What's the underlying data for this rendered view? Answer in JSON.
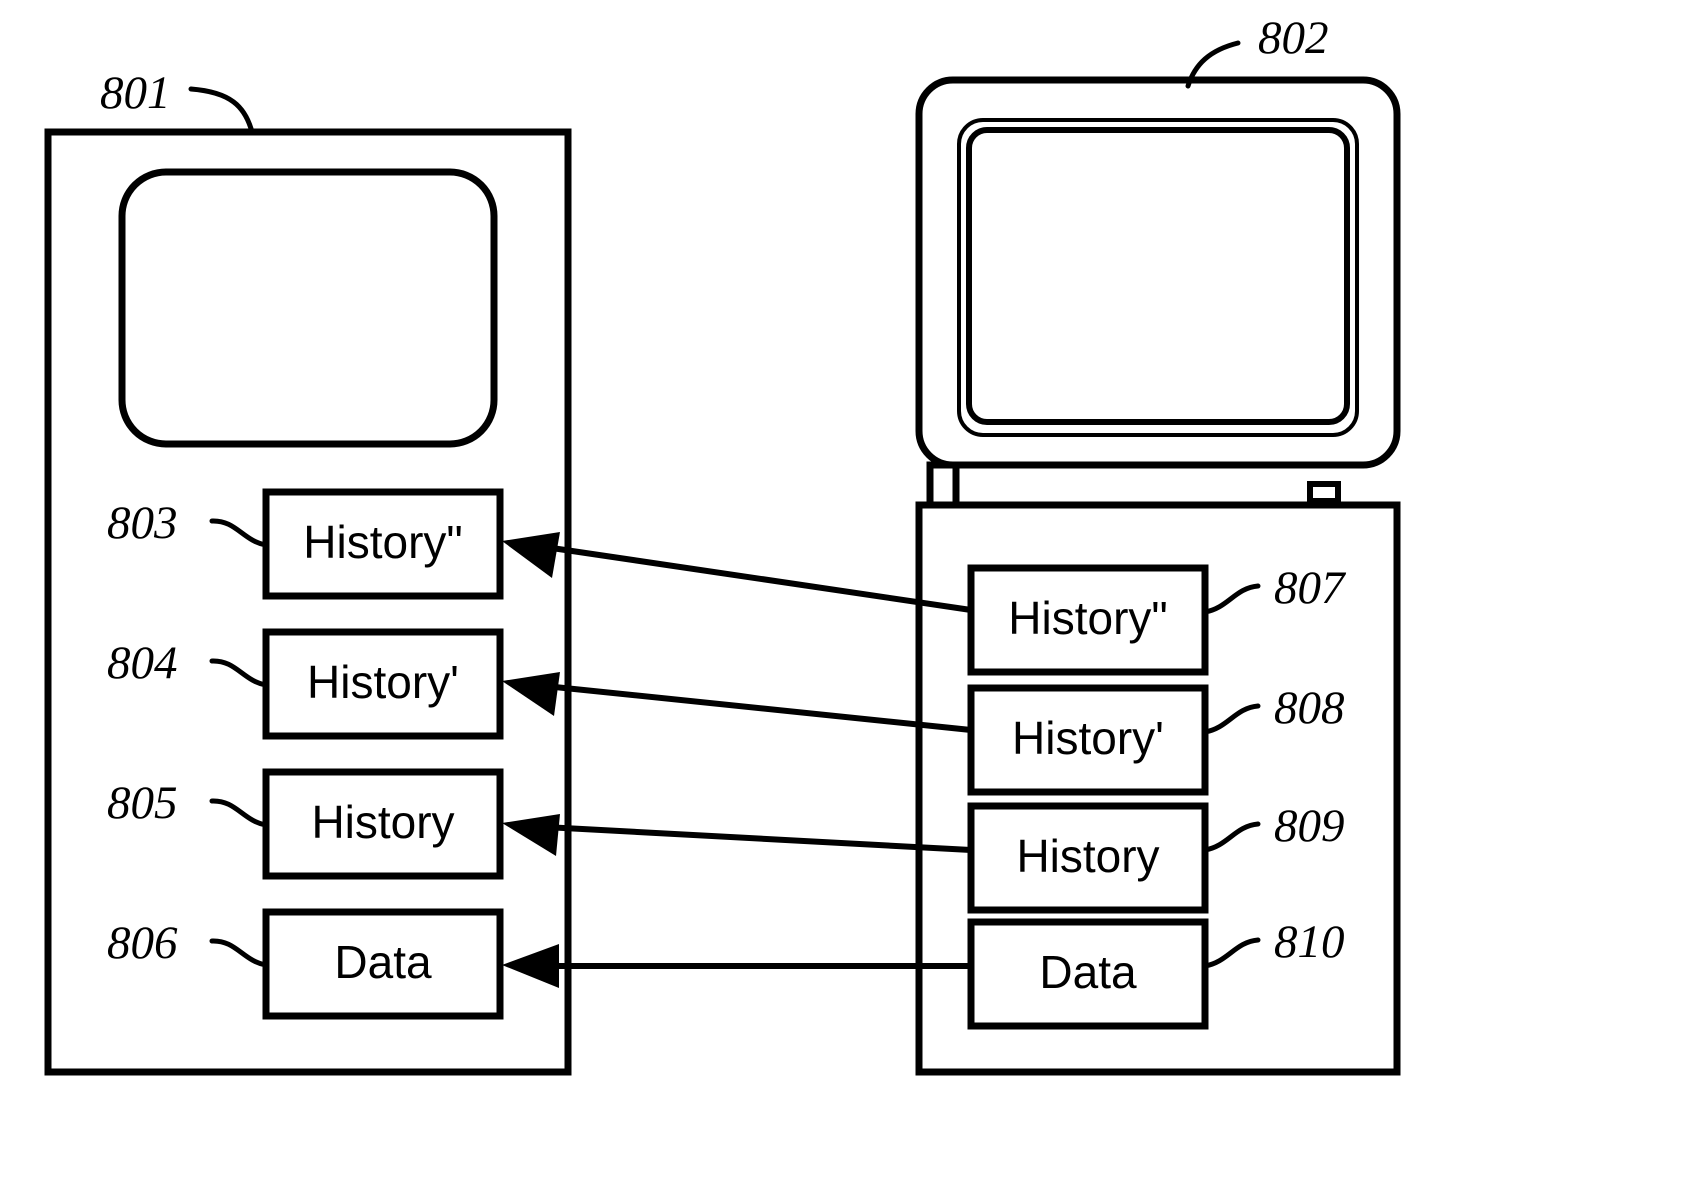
{
  "figure": {
    "type": "patent-diagram",
    "background_color": "#ffffff",
    "line_color": "#000000"
  },
  "devices": [
    {
      "id": "left-device",
      "ref": "801",
      "kind": "handheld-device",
      "screen": "blank-rounded-screen"
    },
    {
      "id": "right-device",
      "ref": "802",
      "kind": "desktop-computer-with-monitor",
      "screen": "blank-crt-screen"
    }
  ],
  "left_blocks": [
    {
      "ref": "803",
      "label": "History\""
    },
    {
      "ref": "804",
      "label": "History'"
    },
    {
      "ref": "805",
      "label": "History"
    },
    {
      "ref": "806",
      "label": "Data"
    }
  ],
  "right_blocks": [
    {
      "ref": "807",
      "label": "History\""
    },
    {
      "ref": "808",
      "label": "History'"
    },
    {
      "ref": "809",
      "label": "History"
    },
    {
      "ref": "810",
      "label": "Data"
    }
  ],
  "arrows": [
    {
      "from": "807",
      "to": "803",
      "direction": "right-to-left"
    },
    {
      "from": "808",
      "to": "804",
      "direction": "right-to-left"
    },
    {
      "from": "809",
      "to": "805",
      "direction": "right-to-left"
    },
    {
      "from": "810",
      "to": "806",
      "direction": "right-to-left"
    }
  ],
  "ref_labels": {
    "device_left": "801",
    "device_right": "802",
    "left_1": "803",
    "left_2": "804",
    "left_3": "805",
    "left_4": "806",
    "right_1": "807",
    "right_2": "808",
    "right_3": "809",
    "right_4": "810"
  },
  "block_labels": {
    "history_double_prime": "History\"",
    "history_prime": "History'",
    "history": "History",
    "data": "Data"
  }
}
